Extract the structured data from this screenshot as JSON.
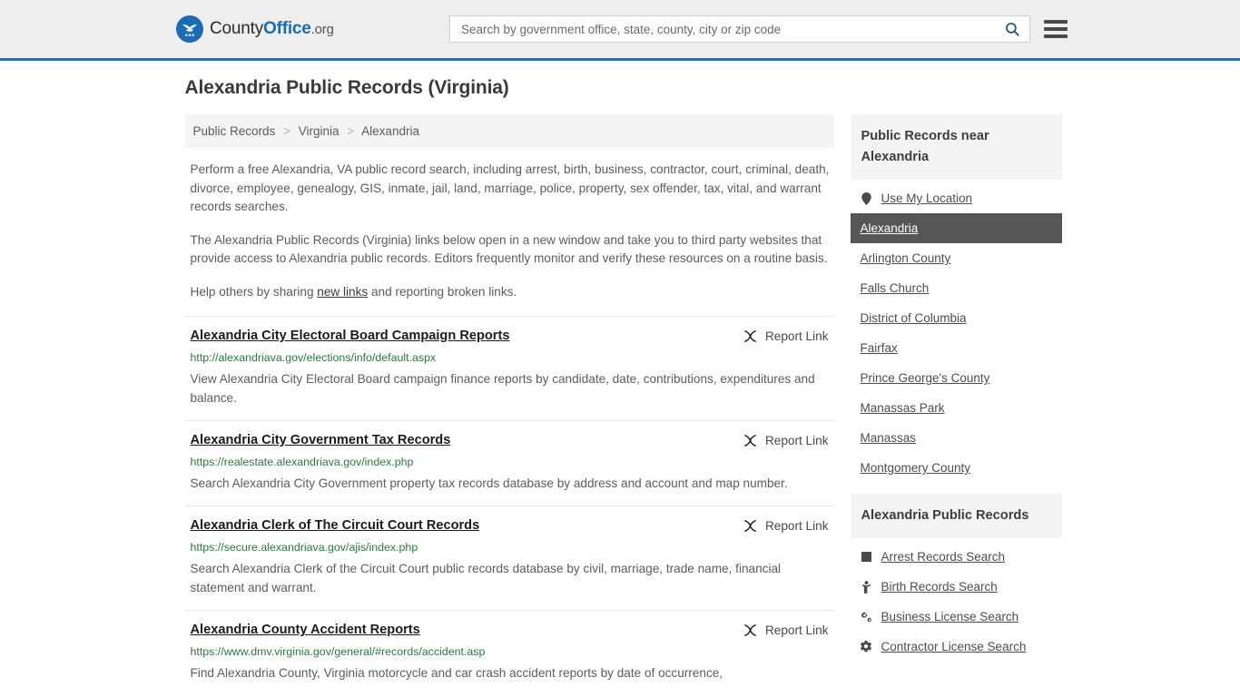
{
  "header": {
    "logo": {
      "part1": "County",
      "part2": "Office",
      "part3": ".org",
      "icon": "eagle-shield-logo"
    },
    "search": {
      "placeholder": "Search by government office, state, county, city or zip code",
      "value": "",
      "button_icon": "search-icon"
    },
    "menu_icon": "hamburger-menu-icon"
  },
  "page": {
    "title": "Alexandria Public Records (Virginia)"
  },
  "breadcrumb": {
    "items": [
      "Public Records",
      "Virginia",
      "Alexandria"
    ],
    "separator": ">"
  },
  "intro": {
    "paragraph1": "Perform a free Alexandria, VA public record search, including arrest, birth, business, contractor, court, criminal, death, divorce, employee, genealogy, GIS, inmate, jail, land, marriage, police, property, sex offender, tax, vital, and warrant records searches.",
    "paragraph2": "The Alexandria Public Records (Virginia) links below open in a new window and take you to third party websites that provide access to Alexandria public records. Editors frequently monitor and verify these resources on a routine basis.",
    "paragraph3_before": "Help others by sharing ",
    "paragraph3_link": "new links",
    "paragraph3_after": " and reporting broken links."
  },
  "results": {
    "report_label": "Report Link",
    "report_icon": "broken-link-icon",
    "items": [
      {
        "title": "Alexandria City Electoral Board Campaign Reports",
        "url": "http://alexandriava.gov/elections/info/default.aspx",
        "description": "View Alexandria City Electoral Board campaign finance reports by candidate, date, contributions, expenditures and balance."
      },
      {
        "title": "Alexandria City Government Tax Records",
        "url": "https://realestate.alexandriava.gov/index.php",
        "description": "Search Alexandria City Government property tax records database by address and account and map number."
      },
      {
        "title": "Alexandria Clerk of The Circuit Court Records",
        "url": "https://secure.alexandriava.gov/ajis/index.php",
        "description": "Search Alexandria Clerk of the Circuit Court public records database by civil, marriage, trade name, financial statement and warrant."
      },
      {
        "title": "Alexandria County Accident Reports",
        "url": "https://www.dmv.virginia.gov/general/#records/accident.asp",
        "description": "Find Alexandria County, Virginia motorcycle and car crash accident reports by date of occurrence,"
      }
    ]
  },
  "sidebar": {
    "nearby": {
      "heading": "Public Records near Alexandria",
      "items": [
        {
          "label": "Use My Location",
          "icon": "map-pin-icon",
          "active": false
        },
        {
          "label": "Alexandria",
          "icon": "",
          "active": true
        },
        {
          "label": "Arlington County",
          "icon": "",
          "active": false
        },
        {
          "label": "Falls Church",
          "icon": "",
          "active": false
        },
        {
          "label": "District of Columbia",
          "icon": "",
          "active": false
        },
        {
          "label": "Fairfax",
          "icon": "",
          "active": false
        },
        {
          "label": "Prince George's County",
          "icon": "",
          "active": false
        },
        {
          "label": "Manassas Park",
          "icon": "",
          "active": false
        },
        {
          "label": "Manassas",
          "icon": "",
          "active": false
        },
        {
          "label": "Montgomery County",
          "icon": "",
          "active": false
        }
      ]
    },
    "records": {
      "heading": "Alexandria Public Records",
      "items": [
        {
          "label": "Arrest Records Search",
          "icon": "fingerprint-square-icon"
        },
        {
          "label": "Birth Records Search",
          "icon": "child-icon"
        },
        {
          "label": "Business License Search",
          "icon": "cogs-icon"
        },
        {
          "label": "Contractor License Search",
          "icon": "gear-icon"
        }
      ]
    }
  },
  "colors": {
    "brand_blue": "#1b6cb5",
    "header_border": "#2e6da4",
    "header_bg": "#eeeeee",
    "url_green": "#2a7a3d",
    "active_bg": "#565656",
    "panel_bg": "#f4f4f4"
  }
}
